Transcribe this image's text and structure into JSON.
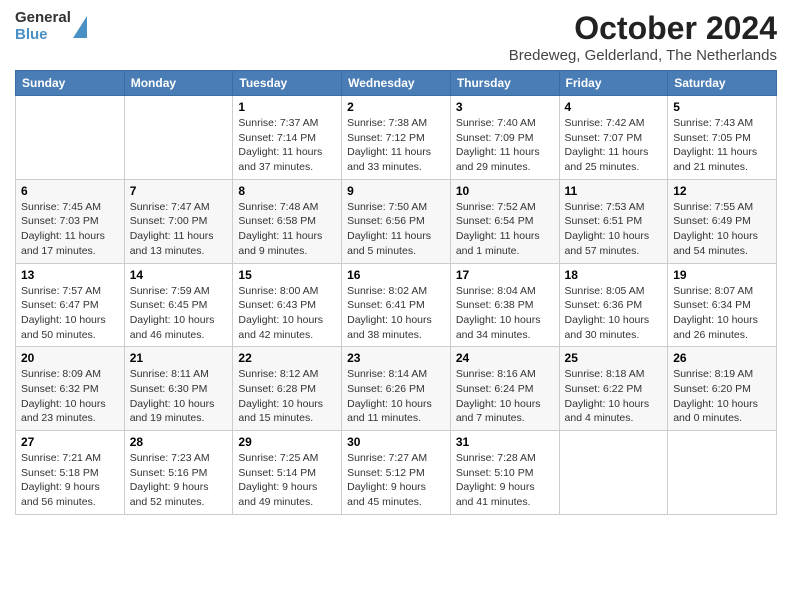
{
  "header": {
    "logo_line1": "General",
    "logo_line2": "Blue",
    "title": "October 2024",
    "subtitle": "Bredeweg, Gelderland, The Netherlands"
  },
  "days_of_week": [
    "Sunday",
    "Monday",
    "Tuesday",
    "Wednesday",
    "Thursday",
    "Friday",
    "Saturday"
  ],
  "weeks": [
    [
      {
        "day": "",
        "info": ""
      },
      {
        "day": "",
        "info": ""
      },
      {
        "day": "1",
        "info": "Sunrise: 7:37 AM\nSunset: 7:14 PM\nDaylight: 11 hours and 37 minutes."
      },
      {
        "day": "2",
        "info": "Sunrise: 7:38 AM\nSunset: 7:12 PM\nDaylight: 11 hours and 33 minutes."
      },
      {
        "day": "3",
        "info": "Sunrise: 7:40 AM\nSunset: 7:09 PM\nDaylight: 11 hours and 29 minutes."
      },
      {
        "day": "4",
        "info": "Sunrise: 7:42 AM\nSunset: 7:07 PM\nDaylight: 11 hours and 25 minutes."
      },
      {
        "day": "5",
        "info": "Sunrise: 7:43 AM\nSunset: 7:05 PM\nDaylight: 11 hours and 21 minutes."
      }
    ],
    [
      {
        "day": "6",
        "info": "Sunrise: 7:45 AM\nSunset: 7:03 PM\nDaylight: 11 hours and 17 minutes."
      },
      {
        "day": "7",
        "info": "Sunrise: 7:47 AM\nSunset: 7:00 PM\nDaylight: 11 hours and 13 minutes."
      },
      {
        "day": "8",
        "info": "Sunrise: 7:48 AM\nSunset: 6:58 PM\nDaylight: 11 hours and 9 minutes."
      },
      {
        "day": "9",
        "info": "Sunrise: 7:50 AM\nSunset: 6:56 PM\nDaylight: 11 hours and 5 minutes."
      },
      {
        "day": "10",
        "info": "Sunrise: 7:52 AM\nSunset: 6:54 PM\nDaylight: 11 hours and 1 minute."
      },
      {
        "day": "11",
        "info": "Sunrise: 7:53 AM\nSunset: 6:51 PM\nDaylight: 10 hours and 57 minutes."
      },
      {
        "day": "12",
        "info": "Sunrise: 7:55 AM\nSunset: 6:49 PM\nDaylight: 10 hours and 54 minutes."
      }
    ],
    [
      {
        "day": "13",
        "info": "Sunrise: 7:57 AM\nSunset: 6:47 PM\nDaylight: 10 hours and 50 minutes."
      },
      {
        "day": "14",
        "info": "Sunrise: 7:59 AM\nSunset: 6:45 PM\nDaylight: 10 hours and 46 minutes."
      },
      {
        "day": "15",
        "info": "Sunrise: 8:00 AM\nSunset: 6:43 PM\nDaylight: 10 hours and 42 minutes."
      },
      {
        "day": "16",
        "info": "Sunrise: 8:02 AM\nSunset: 6:41 PM\nDaylight: 10 hours and 38 minutes."
      },
      {
        "day": "17",
        "info": "Sunrise: 8:04 AM\nSunset: 6:38 PM\nDaylight: 10 hours and 34 minutes."
      },
      {
        "day": "18",
        "info": "Sunrise: 8:05 AM\nSunset: 6:36 PM\nDaylight: 10 hours and 30 minutes."
      },
      {
        "day": "19",
        "info": "Sunrise: 8:07 AM\nSunset: 6:34 PM\nDaylight: 10 hours and 26 minutes."
      }
    ],
    [
      {
        "day": "20",
        "info": "Sunrise: 8:09 AM\nSunset: 6:32 PM\nDaylight: 10 hours and 23 minutes."
      },
      {
        "day": "21",
        "info": "Sunrise: 8:11 AM\nSunset: 6:30 PM\nDaylight: 10 hours and 19 minutes."
      },
      {
        "day": "22",
        "info": "Sunrise: 8:12 AM\nSunset: 6:28 PM\nDaylight: 10 hours and 15 minutes."
      },
      {
        "day": "23",
        "info": "Sunrise: 8:14 AM\nSunset: 6:26 PM\nDaylight: 10 hours and 11 minutes."
      },
      {
        "day": "24",
        "info": "Sunrise: 8:16 AM\nSunset: 6:24 PM\nDaylight: 10 hours and 7 minutes."
      },
      {
        "day": "25",
        "info": "Sunrise: 8:18 AM\nSunset: 6:22 PM\nDaylight: 10 hours and 4 minutes."
      },
      {
        "day": "26",
        "info": "Sunrise: 8:19 AM\nSunset: 6:20 PM\nDaylight: 10 hours and 0 minutes."
      }
    ],
    [
      {
        "day": "27",
        "info": "Sunrise: 7:21 AM\nSunset: 5:18 PM\nDaylight: 9 hours and 56 minutes."
      },
      {
        "day": "28",
        "info": "Sunrise: 7:23 AM\nSunset: 5:16 PM\nDaylight: 9 hours and 52 minutes."
      },
      {
        "day": "29",
        "info": "Sunrise: 7:25 AM\nSunset: 5:14 PM\nDaylight: 9 hours and 49 minutes."
      },
      {
        "day": "30",
        "info": "Sunrise: 7:27 AM\nSunset: 5:12 PM\nDaylight: 9 hours and 45 minutes."
      },
      {
        "day": "31",
        "info": "Sunrise: 7:28 AM\nSunset: 5:10 PM\nDaylight: 9 hours and 41 minutes."
      },
      {
        "day": "",
        "info": ""
      },
      {
        "day": "",
        "info": ""
      }
    ]
  ]
}
